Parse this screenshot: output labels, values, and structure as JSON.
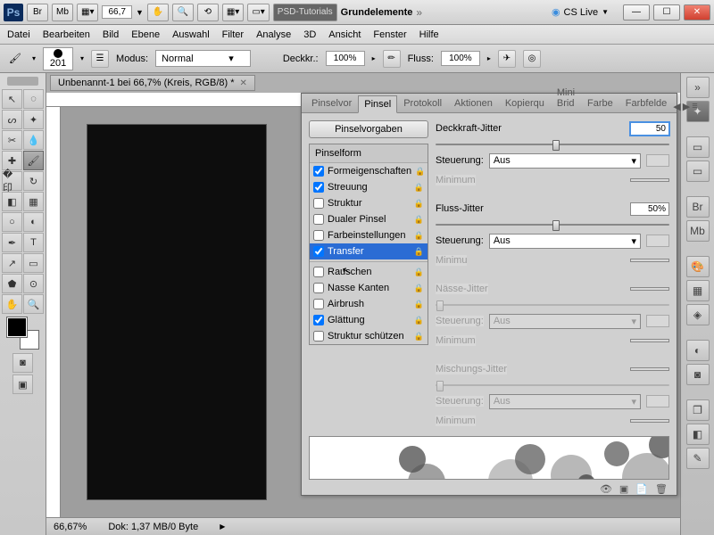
{
  "titlebar": {
    "zoom": "66,7",
    "workspace1": "PSD-Tutorials",
    "workspace2": "Grundelemente",
    "cslive": "CS Live"
  },
  "menu": [
    "Datei",
    "Bearbeiten",
    "Bild",
    "Ebene",
    "Auswahl",
    "Filter",
    "Analyse",
    "3D",
    "Ansicht",
    "Fenster",
    "Hilfe"
  ],
  "options": {
    "brush_size": "201",
    "mode_label": "Modus:",
    "mode_value": "Normal",
    "opacity_label": "Deckkr.:",
    "opacity_value": "100%",
    "flow_label": "Fluss:",
    "flow_value": "100%"
  },
  "document": {
    "tab_title": "Unbenannt-1 bei 66,7% (Kreis, RGB/8) *"
  },
  "status": {
    "zoom": "66,67%",
    "doc_info": "Dok: 1,37 MB/0 Byte"
  },
  "brush_panel": {
    "tabs": [
      "Pinselvor",
      "Pinsel",
      "Protokoll",
      "Aktionen",
      "Kopierqu",
      "Mini Brid",
      "Farbe",
      "Farbfelde"
    ],
    "active_tab": 1,
    "presets_btn": "Pinselvorgaben",
    "shape_header": "Pinselform",
    "shape_items": [
      {
        "label": "Formeigenschaften",
        "checked": true,
        "locked": true
      },
      {
        "label": "Streuung",
        "checked": true,
        "locked": true
      },
      {
        "label": "Struktur",
        "checked": false,
        "locked": true
      },
      {
        "label": "Dualer Pinsel",
        "checked": false,
        "locked": true
      },
      {
        "label": "Farbeinstellungen",
        "checked": false,
        "locked": true
      },
      {
        "label": "Transfer",
        "checked": true,
        "locked": true,
        "selected": true
      },
      {
        "label": "Rauschen",
        "checked": false,
        "locked": true,
        "sep": true,
        "cursor": true
      },
      {
        "label": "Nasse Kanten",
        "checked": false,
        "locked": true
      },
      {
        "label": "Airbrush",
        "checked": false,
        "locked": true
      },
      {
        "label": "Glättung",
        "checked": true,
        "locked": true
      },
      {
        "label": "Struktur schützen",
        "checked": false,
        "locked": true
      }
    ],
    "right": {
      "opacity_jitter_label": "Deckkraft-Jitter",
      "opacity_jitter_value": "50",
      "control_label": "Steuerung:",
      "control_value": "Aus",
      "minimum_label": "Minimum",
      "flow_jitter_label": "Fluss-Jitter",
      "flow_jitter_value": "50%",
      "control2_value": "Aus",
      "minim_label": "Minimu",
      "wetness_label": "Nässe-Jitter",
      "control3_value": "Aus",
      "mix_label": "Mischungs-Jitter",
      "control4_value": "Aus"
    }
  }
}
